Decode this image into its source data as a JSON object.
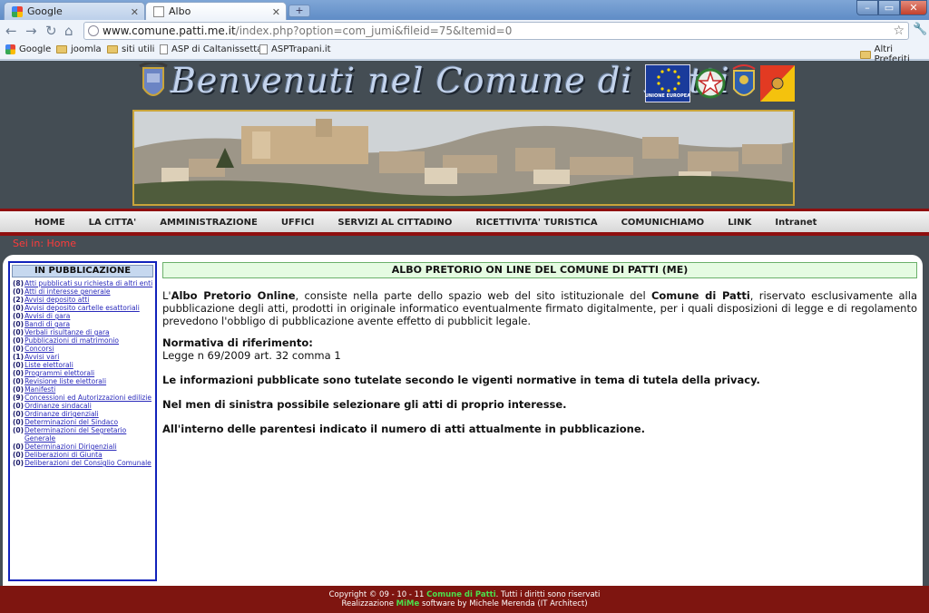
{
  "browser": {
    "tabs": [
      {
        "label": "Google",
        "active": false
      },
      {
        "label": "Albo",
        "active": true
      }
    ],
    "new_tab_icon": "plus-icon",
    "window_buttons": {
      "minimize": "–",
      "maximize": "▭",
      "close": "✕"
    },
    "url_host": "www.comune.patti.me.it",
    "url_rest": "/index.php?option=com_jumi&fileid=75&Itemid=0",
    "bookmarks": [
      {
        "label": "Google",
        "icon": "google-icon"
      },
      {
        "label": "joomla",
        "icon": "folder-icon"
      },
      {
        "label": "siti utili",
        "icon": "folder-icon"
      },
      {
        "label": "ASP di Caltanissetta",
        "icon": "page-icon"
      },
      {
        "label": "ASPTrapani.it",
        "icon": "page-icon"
      }
    ],
    "other_bookmarks": "Altri Preferiti"
  },
  "header": {
    "title": "Benvenuti nel Comune di Patti",
    "eu_caption": "UNIONE EUROPEA",
    "colors": {
      "eu_blue": "#1a3b9b",
      "frame_gold": "#c9a43a",
      "nav_red": "#8f0f0f"
    }
  },
  "topnav": [
    "HOME",
    "LA CITTA'",
    "AMMINISTRAZIONE",
    "UFFICI",
    "SERVIZI AL CITTADINO",
    "RICETTIVITA' TURISTICA",
    "COMUNICHIAMO",
    "LINK",
    "Intranet"
  ],
  "breadcrumb": "Sei in: Home",
  "sidebar": {
    "title": "IN PUBBLICAZIONE",
    "items": [
      {
        "count": "(8)",
        "label": "Atti pubblicati su richiesta di altri enti"
      },
      {
        "count": "(0)",
        "label": "Atti di interesse generale"
      },
      {
        "count": "(2)",
        "label": "Avvisi deposito atti"
      },
      {
        "count": "(0)",
        "label": "Avvisi deposito cartelle esattoriali"
      },
      {
        "count": "(0)",
        "label": "Avvisi di gara"
      },
      {
        "count": "(0)",
        "label": "Bandi di gara"
      },
      {
        "count": "(0)",
        "label": "Verbali risultanze di gara"
      },
      {
        "count": "(0)",
        "label": "Pubblicazioni di matrimonio"
      },
      {
        "count": "(0)",
        "label": "Concorsi"
      },
      {
        "count": "(1)",
        "label": "Avvisi vari"
      },
      {
        "count": "(0)",
        "label": "Liste elettorali"
      },
      {
        "count": "(0)",
        "label": "Programmi elettorali"
      },
      {
        "count": "(0)",
        "label": "Revisione liste elettorali"
      },
      {
        "count": "(0)",
        "label": "Manifesti"
      },
      {
        "count": "(9)",
        "label": "Concessioni ed Autorizzazioni edilizie"
      },
      {
        "count": "(0)",
        "label": "Ordinanze sindacali"
      },
      {
        "count": "(0)",
        "label": "Ordinanze dirigenziali"
      },
      {
        "count": "(0)",
        "label": "Determinazioni del Sindaco"
      },
      {
        "count": "(0)",
        "label": "Determinazioni del Segretario Generale"
      },
      {
        "count": "(0)",
        "label": "Determinazioni Dirigenziali"
      },
      {
        "count": "(0)",
        "label": "Deliberazioni di Giunta"
      },
      {
        "count": "(0)",
        "label": "Deliberazioni del Consiglio Comunale"
      }
    ]
  },
  "main": {
    "title": "ALBO PRETORIO ON LINE DEL COMUNE DI PATTI (ME)",
    "intro_1": "L'",
    "intro_b1": "Albo Pretorio Online",
    "intro_2": ", consiste nella parte dello spazio web del sito istituzionale del ",
    "intro_b2": "Comune di Patti",
    "intro_3": ", riservato esclusivamente alla pubblicazione degli atti, prodotti in originale informatico eventualmente firmato digitalmente, per i quali disposizioni di legge e di regolamento prevedono l'obbligo di pubblicazione avente effetto di pubblicit legale.",
    "norm_heading": "Normativa di riferimento:",
    "norm_text": "Legge n 69/2009 art. 32 comma 1",
    "statements": [
      "Le informazioni pubblicate sono tutelate secondo le vigenti normative in tema di tutela della privacy.",
      "Nel men di sinistra possibile selezionare gli atti di proprio interesse.",
      "All'interno delle parentesi indicato il numero di atti attualmente in pubblicazione."
    ]
  },
  "footer": {
    "line1_a": "Copyright © 09 - 10 - 11 ",
    "line1_b": "Comune di Patti",
    "line1_c": ". Tutti i diritti sono riservati",
    "line2_a": "Realizzazione ",
    "line2_b": "MiMe",
    "line2_c": " software by ",
    "line2_d": "Michele Merenda",
    "line2_e": " (IT Architect)"
  }
}
